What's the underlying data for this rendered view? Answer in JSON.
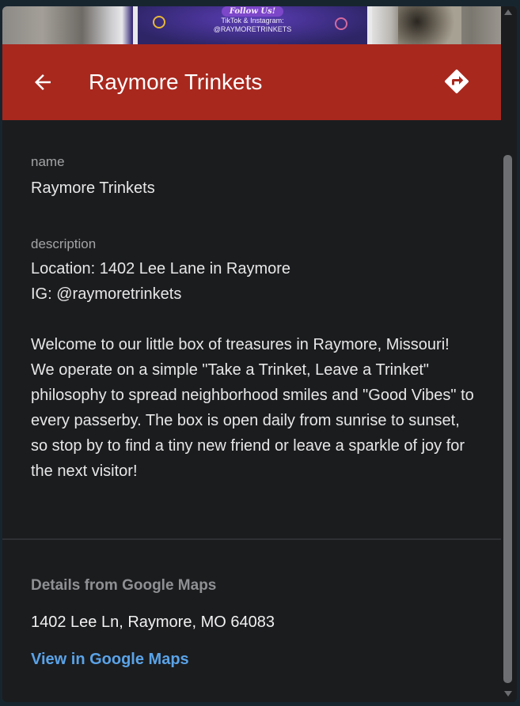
{
  "hero": {
    "follow_text": "Follow Us!",
    "social_line1": "TikTok & Instagram:",
    "social_line2": "@RAYMORETRINKETS"
  },
  "appbar": {
    "back_icon": "arrow-left-icon",
    "title": "Raymore Trinkets",
    "directions_icon": "directions-icon",
    "color": "#a8281e"
  },
  "fields": {
    "name_label": "name",
    "name_value": "Raymore Trinkets",
    "description_label": "description",
    "description_lines": [
      "Location: 1402 Lee Lane in Raymore",
      "IG: @raymoretrinkets"
    ],
    "description_body": "Welcome to our little box of treasures in Raymore, Missouri! We operate on a simple \"Take a Trinket, Leave a Trinket\" philosophy to spread neighborhood smiles and \"Good Vibes\" to every passerby. The box is open daily from sunrise to sunset, so stop by to find a tiny new friend or leave a sparkle of joy for the next visitor!"
  },
  "google_maps": {
    "header": "Details from Google Maps",
    "address": "1402 Lee Ln, Raymore, MO 64083",
    "link_label": "View in Google Maps",
    "link_color": "#5aa3e8"
  }
}
